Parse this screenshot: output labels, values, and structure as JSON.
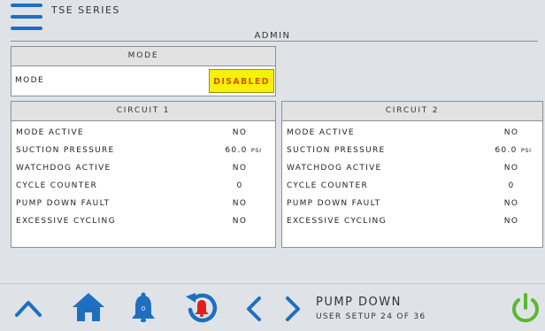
{
  "header": {
    "series": "TSE SERIES",
    "user": "ADMIN"
  },
  "mode_panel": {
    "header": "MODE",
    "label": "MODE",
    "value": "DISABLED"
  },
  "circuits": [
    {
      "header": "CIRCUIT 1",
      "rows": [
        {
          "label": "MODE ACTIVE",
          "value": "NO",
          "unit": ""
        },
        {
          "label": "SUCTION PRESSURE",
          "value": "60.0",
          "unit": "PSI"
        },
        {
          "label": "WATCHDOG ACTIVE",
          "value": "NO",
          "unit": ""
        },
        {
          "label": "CYCLE COUNTER",
          "value": "0",
          "unit": ""
        },
        {
          "label": "PUMP DOWN FAULT",
          "value": "NO",
          "unit": ""
        },
        {
          "label": "EXCESSIVE CYCLING",
          "value": "NO",
          "unit": ""
        }
      ]
    },
    {
      "header": "CIRCUIT 2",
      "rows": [
        {
          "label": "MODE ACTIVE",
          "value": "NO",
          "unit": ""
        },
        {
          "label": "SUCTION PRESSURE",
          "value": "60.0",
          "unit": "PSI"
        },
        {
          "label": "WATCHDOG ACTIVE",
          "value": "NO",
          "unit": ""
        },
        {
          "label": "CYCLE COUNTER",
          "value": "0",
          "unit": ""
        },
        {
          "label": "PUMP DOWN FAULT",
          "value": "NO",
          "unit": ""
        },
        {
          "label": "EXCESSIVE CYCLING",
          "value": "NO",
          "unit": ""
        }
      ]
    }
  ],
  "footer": {
    "screen_title": "PUMP DOWN",
    "screen_sub": "USER SETUP 24 OF 36",
    "alarm_count": "0",
    "icons": [
      "up-arrow-icon",
      "home-icon",
      "bell-icon",
      "alarm-history-icon",
      "chevron-left-icon",
      "chevron-right-icon",
      "power-icon"
    ]
  },
  "colors": {
    "accent": "#1e6fc0",
    "alarm": "#e0201e",
    "power": "#5ab82e",
    "disabled_bg": "#f6f00c",
    "disabled_text": "#d05a00"
  }
}
